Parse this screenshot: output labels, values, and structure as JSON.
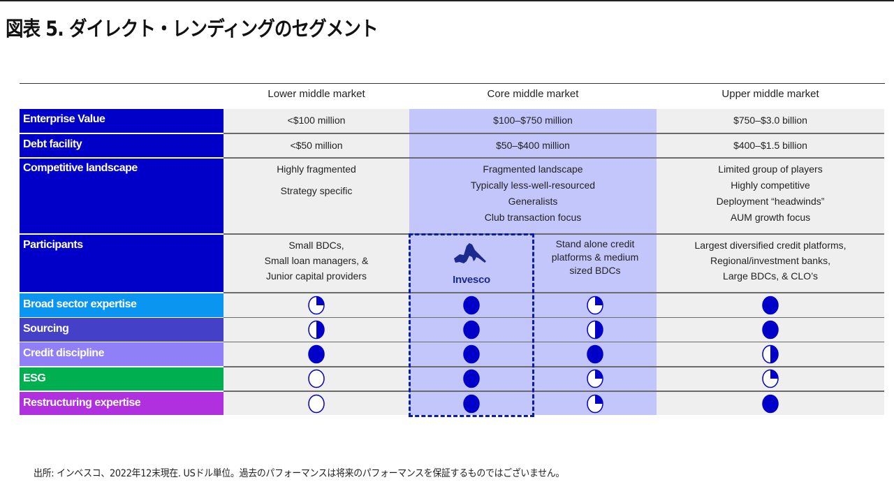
{
  "title": "図表 5. ダイレクト・レンディングのセグメント",
  "columns": [
    "Lower middle market",
    "Core middle market",
    "Upper middle market"
  ],
  "rows": {
    "enterprise_value": {
      "label": "Enterprise Value",
      "values": [
        "<$100 million",
        "$100–$750 million",
        "$750–$3.0 billion"
      ]
    },
    "debt_facility": {
      "label": "Debt facility",
      "values": [
        "<$50 million",
        "$50–$400 million",
        "$400–$1.5 billion"
      ]
    },
    "competitive_landscape": {
      "label": "Competitive landscape",
      "lower": [
        "Highly fragmented",
        "Strategy specific"
      ],
      "core": [
        "Fragmented landscape",
        "Typically less-well-resourced",
        "Generalists",
        "Club transaction focus"
      ],
      "upper": [
        "Limited group of players",
        "Highly competitive",
        "Deployment “headwinds”",
        "AUM growth focus"
      ]
    },
    "participants": {
      "label": "Participants",
      "lower": [
        "Small BDCs,",
        "Small loan managers, &",
        "Junior capital providers"
      ],
      "core_logo": "Invesco",
      "core_other": [
        "Stand alone credit",
        "platforms & medium",
        "sized BDCs"
      ],
      "upper": [
        "Largest diversified credit platforms,",
        "Regional/investment  banks,",
        "Large BDCs, & CLO’s"
      ]
    }
  },
  "ratings_legend": "Harvey ball fill fraction: 0 = empty, 0.25 = quarter, 0.5 = half, 1 = full",
  "rating_columns": [
    "Lower middle market",
    "Invesco",
    "Core middle market (other)",
    "Upper middle market"
  ],
  "ratings": [
    {
      "label": "Broad sector expertise",
      "color": "#0a96f0",
      "values": [
        0.25,
        1,
        0.25,
        1
      ]
    },
    {
      "label": "Sourcing",
      "color": "#4540c8",
      "values": [
        0.5,
        1,
        0.5,
        1
      ]
    },
    {
      "label": "Credit discipline",
      "color": "#8f80f8",
      "values": [
        1,
        1,
        1,
        0.5
      ]
    },
    {
      "label": "ESG",
      "color": "#00b050",
      "values": [
        0,
        1,
        0.25,
        0.25
      ]
    },
    {
      "label": "Restructuring expertise",
      "color": "#b030e0",
      "values": [
        0,
        1,
        0.25,
        1
      ]
    }
  ],
  "colors": {
    "label_primary": "#0000c8",
    "core_highlight": "#c3c6fb",
    "cell_grey": "#efefef",
    "harvey_ball": "#0000c8",
    "invesco_dash": "#0b1ea8"
  },
  "footnote": "出所: インベスコ、2022年12末現在. USドル単位。過去のパフォーマンスは将来のパフォーマンスを保証するものではございません。"
}
